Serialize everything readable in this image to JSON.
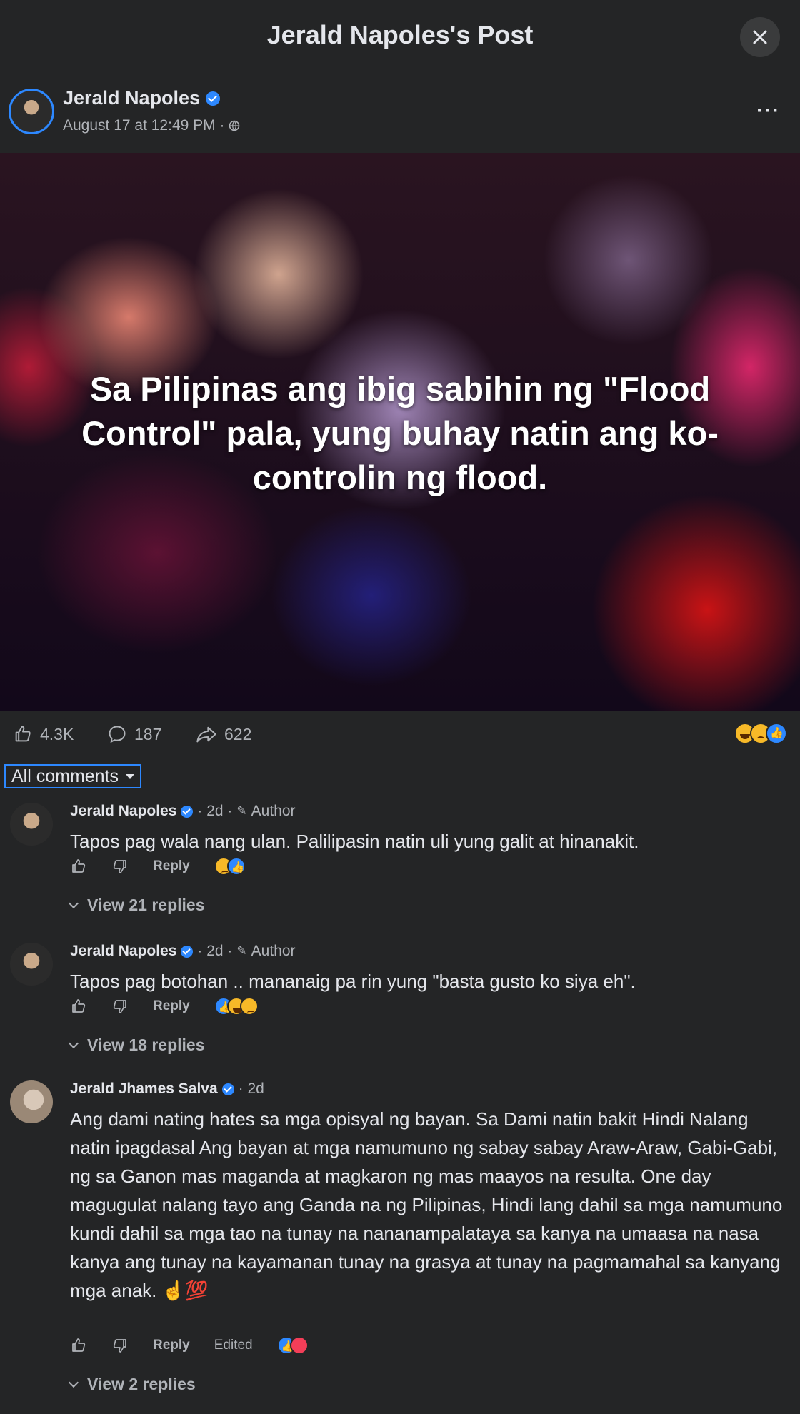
{
  "header": {
    "title": "Jerald Napoles's Post"
  },
  "post": {
    "author": "Jerald Napoles",
    "timestamp": "August 17 at 12:49 PM ·",
    "image_text": "Sa Pilipinas ang ibig sabihin ng \"Flood Control\" pala, yung buhay natin ang ko-controlin ng flood.",
    "stats": {
      "likes": "4.3K",
      "comments": "187",
      "shares": "622"
    }
  },
  "filter": {
    "label": "All comments"
  },
  "comments": [
    {
      "name": "Jerald Napoles",
      "meta": "· 2d ·",
      "badge": "Author",
      "text": "Tapos pag wala nang ulan. Palilipasin natin uli yung galit at hinanakit.",
      "reply_label": "Reply",
      "view_replies": "View 21 replies"
    },
    {
      "name": "Jerald Napoles",
      "meta": "· 2d ·",
      "badge": "Author",
      "text": "Tapos pag botohan .. mananaig pa rin yung \"basta gusto ko siya eh\".",
      "reply_label": "Reply",
      "view_replies": "View 18 replies"
    },
    {
      "name": "Jerald Jhames Salva",
      "meta": "· 2d",
      "text": "Ang dami nating hates sa mga opisyal ng bayan. Sa Dami natin bakit Hindi Nalang natin ipagdasal Ang bayan at mga namumuno ng sabay sabay Araw-Araw, Gabi-Gabi, ng sa Ganon mas maganda at magkaron ng mas maayos na resulta. One day magugulat nalang tayo ang Ganda na ng Pilipinas, Hindi lang dahil sa mga namumuno kundi dahil sa mga tao na tunay na nananampalataya sa kanya na umaasa na nasa kanya ang tunay na kayamanan tunay na grasya at tunay na pagmamahal sa kanyang mga anak. ☝💯",
      "reply_label": "Reply",
      "edited_label": "Edited",
      "view_replies": "View 2 replies"
    }
  ]
}
